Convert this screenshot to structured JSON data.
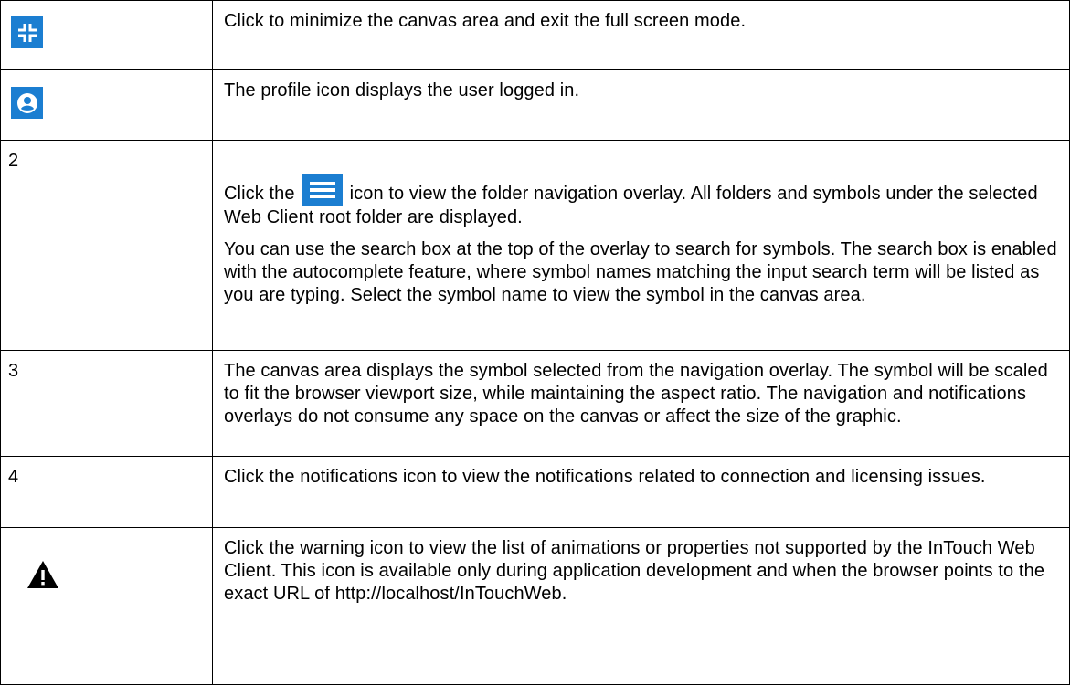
{
  "rows": [
    {
      "icon": "fullscreen-exit-icon",
      "description": "Click to minimize the canvas area and exit the full screen mode."
    },
    {
      "icon": "profile-icon",
      "description": "The profile icon displays the user logged in."
    },
    {
      "number": "2",
      "inline_icon": "hamburger-menu-icon",
      "description_before": "Click the",
      "description_after": "icon to view the folder navigation overlay. All folders and symbols under the selected Web Client root folder are displayed.",
      "description_2": "You can use the search box at the top of the overlay to search for symbols. The search box is enabled with the autocomplete feature, where symbol names matching the input search term will be listed as you are typing. Select the symbol name to view the symbol in the canvas area."
    },
    {
      "number": "3",
      "description": "The canvas area displays the symbol selected from the navigation overlay. The symbol will be scaled to fit the browser viewport size, while maintaining the aspect ratio. The navigation and notifications overlays do not consume any space on the canvas or affect the size of the graphic."
    },
    {
      "number": "4",
      "description": "Click the notifications icon to view the notifications related to connection and licensing issues."
    },
    {
      "icon": "warning-icon",
      "description": "Click the warning icon to view the list of animations or properties not supported by the InTouch Web Client. This icon is available only during application development and when the browser points to the exact URL of http://localhost/InTouchWeb."
    }
  ],
  "colors": {
    "icon_blue": "#1b7ed1",
    "border": "#000000",
    "text": "#000000"
  }
}
